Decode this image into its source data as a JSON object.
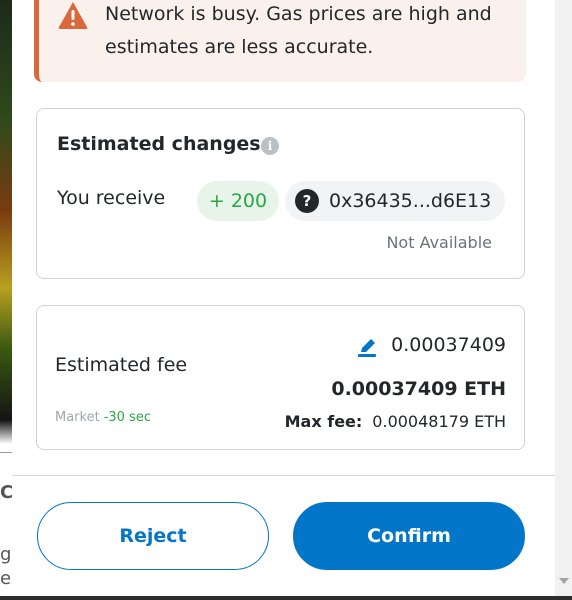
{
  "warning": {
    "icon": "warning-triangle-icon",
    "message": "Network is busy. Gas prices are high and estimates are less accurate."
  },
  "estimated_changes": {
    "title": "Estimated changes",
    "info_icon": "info-icon",
    "receive_label": "You receive",
    "amount": "+ 200",
    "token_icon": "unknown-token-icon",
    "token_icon_glyph": "?",
    "token_address": "0x36435...d6E13",
    "value_status": "Not Available"
  },
  "fee": {
    "edit_icon": "edit-pencil-icon",
    "small_value": "0.00037409",
    "label": "Estimated fee",
    "total": "0.00037409 ETH",
    "speed": "Market",
    "time": "-30 sec",
    "max_fee_label": "Max fee:",
    "max_fee_value": "0.00048179 ETH"
  },
  "actions": {
    "reject": "Reject",
    "confirm": "Confirm"
  },
  "background": {
    "text_1": "C",
    "text_2": "g",
    "text_3": "e"
  },
  "colors": {
    "primary": "#0376c9",
    "warning": "#d9683a",
    "success": "#28a745"
  }
}
